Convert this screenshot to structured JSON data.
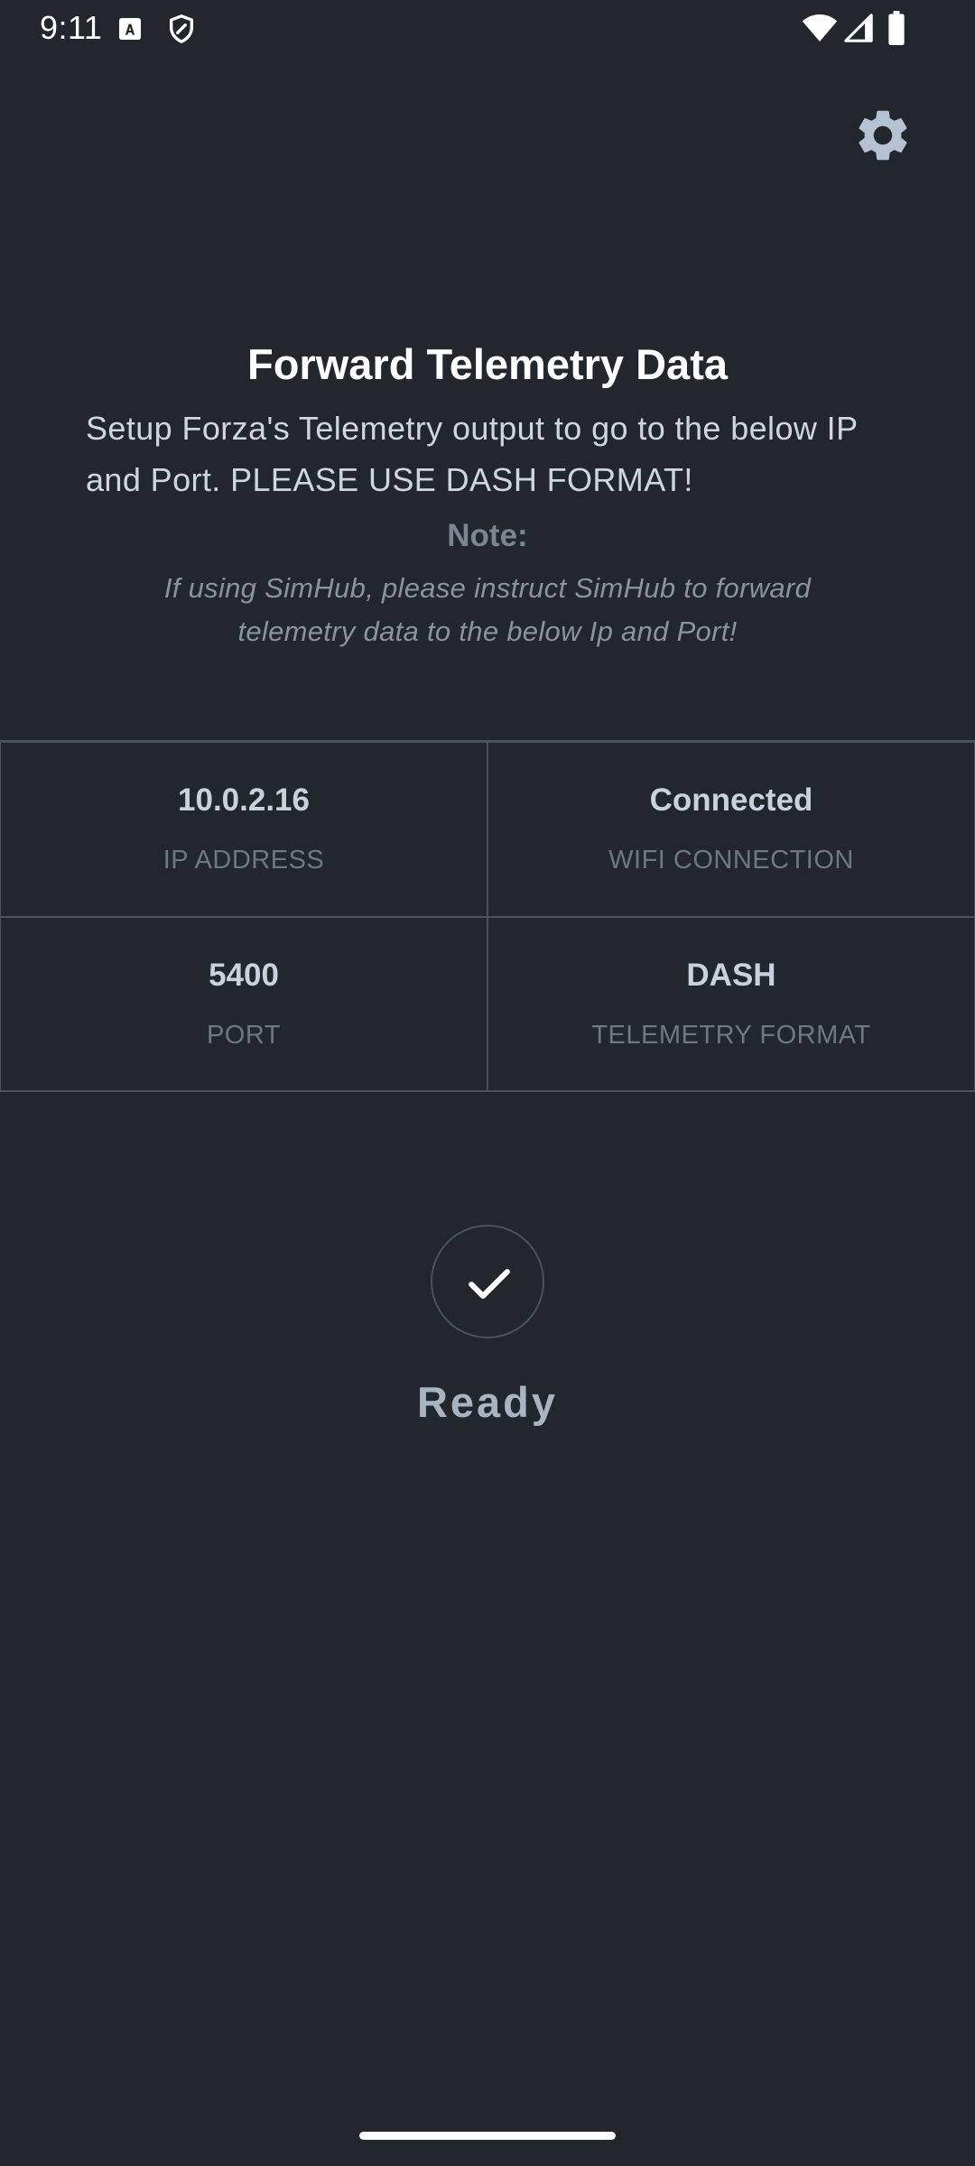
{
  "status_bar": {
    "time": "9:11",
    "icons": [
      "a-notification-icon",
      "shield-icon",
      "wifi-icon",
      "signal-icon",
      "battery-icon"
    ]
  },
  "header": {
    "settings_icon": "gear-icon"
  },
  "intro": {
    "title": "Forward Telemetry Data",
    "setup_text": "Setup Forza's Telemetry output to go to the below IP and Port. PLEASE USE DASH FORMAT!",
    "note_label": "Note:",
    "note_text": "If using SimHub, please instruct SimHub to forward telemetry data to the below Ip and Port!"
  },
  "info": {
    "ip_address": {
      "value": "10.0.2.16",
      "label": "IP ADDRESS"
    },
    "wifi": {
      "value": "Connected",
      "label": "WIFI CONNECTION"
    },
    "port": {
      "value": "5400",
      "label": "PORT"
    },
    "format": {
      "value": "DASH",
      "label": "TELEMETRY FORMAT"
    }
  },
  "status": {
    "icon": "check-icon",
    "label": "Ready"
  },
  "colors": {
    "background": "#22272d",
    "border": "#4b525b",
    "title": "#ffffff",
    "value_text": "#c9d1dc",
    "muted_label": "#6f7781",
    "ready_text": "#a9b4c2",
    "gear": "#b4c2d4"
  }
}
